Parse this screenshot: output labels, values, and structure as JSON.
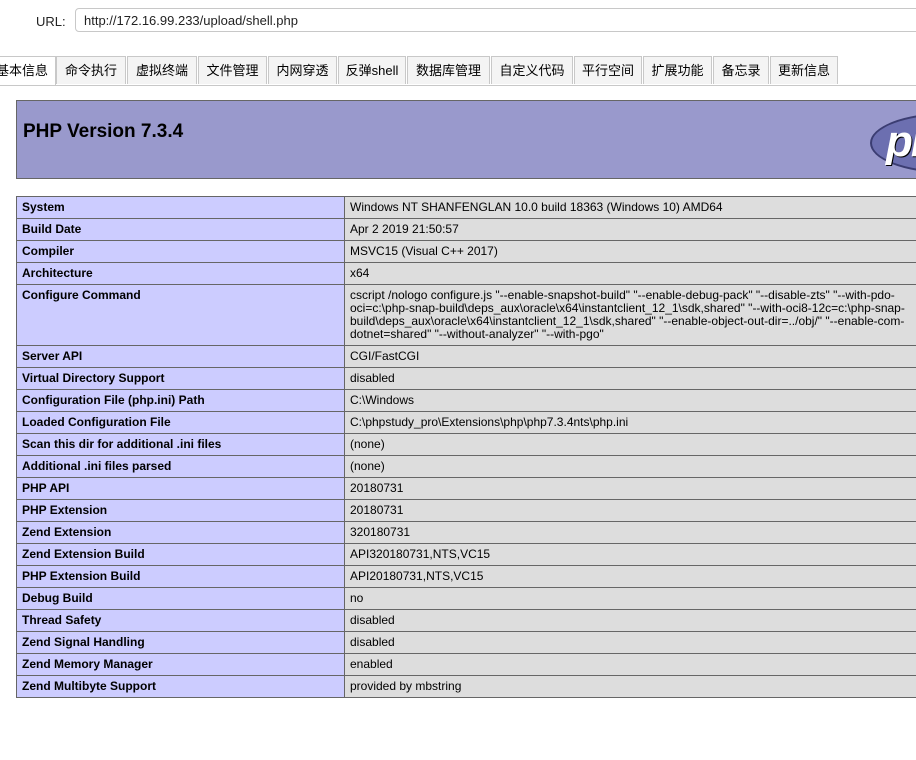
{
  "urlbar": {
    "label": "URL:",
    "value": "http://172.16.99.233/upload/shell.php"
  },
  "tabs": [
    {
      "label": "基本信息",
      "active": true
    },
    {
      "label": "命令执行"
    },
    {
      "label": "虚拟终端"
    },
    {
      "label": "文件管理"
    },
    {
      "label": "内网穿透"
    },
    {
      "label": "反弹shell"
    },
    {
      "label": "数据库管理"
    },
    {
      "label": "自定义代码"
    },
    {
      "label": "平行空间"
    },
    {
      "label": "扩展功能"
    },
    {
      "label": "备忘录"
    },
    {
      "label": "更新信息"
    }
  ],
  "phpinfo": {
    "title": "PHP Version 7.3.4",
    "logo_text": "php",
    "rows": [
      {
        "key": "System",
        "value": "Windows NT SHANFENGLAN 10.0 build 18363 (Windows 10) AMD64"
      },
      {
        "key": "Build Date",
        "value": "Apr 2 2019 21:50:57"
      },
      {
        "key": "Compiler",
        "value": "MSVC15 (Visual C++ 2017)"
      },
      {
        "key": "Architecture",
        "value": "x64"
      },
      {
        "key": "Configure Command",
        "value": "cscript /nologo configure.js \"--enable-snapshot-build\" \"--enable-debug-pack\" \"--disable-zts\" \"--with-pdo-oci=c:\\php-snap-build\\deps_aux\\oracle\\x64\\instantclient_12_1\\sdk,shared\" \"--with-oci8-12c=c:\\php-snap-build\\deps_aux\\oracle\\x64\\instantclient_12_1\\sdk,shared\" \"--enable-object-out-dir=../obj/\" \"--enable-com-dotnet=shared\" \"--without-analyzer\" \"--with-pgo\""
      },
      {
        "key": "Server API",
        "value": "CGI/FastCGI"
      },
      {
        "key": "Virtual Directory Support",
        "value": "disabled"
      },
      {
        "key": "Configuration File (php.ini) Path",
        "value": "C:\\Windows"
      },
      {
        "key": "Loaded Configuration File",
        "value": "C:\\phpstudy_pro\\Extensions\\php\\php7.3.4nts\\php.ini"
      },
      {
        "key": "Scan this dir for additional .ini files",
        "value": "(none)"
      },
      {
        "key": "Additional .ini files parsed",
        "value": "(none)"
      },
      {
        "key": "PHP API",
        "value": "20180731"
      },
      {
        "key": "PHP Extension",
        "value": "20180731"
      },
      {
        "key": "Zend Extension",
        "value": "320180731"
      },
      {
        "key": "Zend Extension Build",
        "value": "API320180731,NTS,VC15"
      },
      {
        "key": "PHP Extension Build",
        "value": "API20180731,NTS,VC15"
      },
      {
        "key": "Debug Build",
        "value": "no"
      },
      {
        "key": "Thread Safety",
        "value": "disabled"
      },
      {
        "key": "Zend Signal Handling",
        "value": "disabled"
      },
      {
        "key": "Zend Memory Manager",
        "value": "enabled"
      },
      {
        "key": "Zend Multibyte Support",
        "value": "provided by mbstring"
      }
    ]
  }
}
